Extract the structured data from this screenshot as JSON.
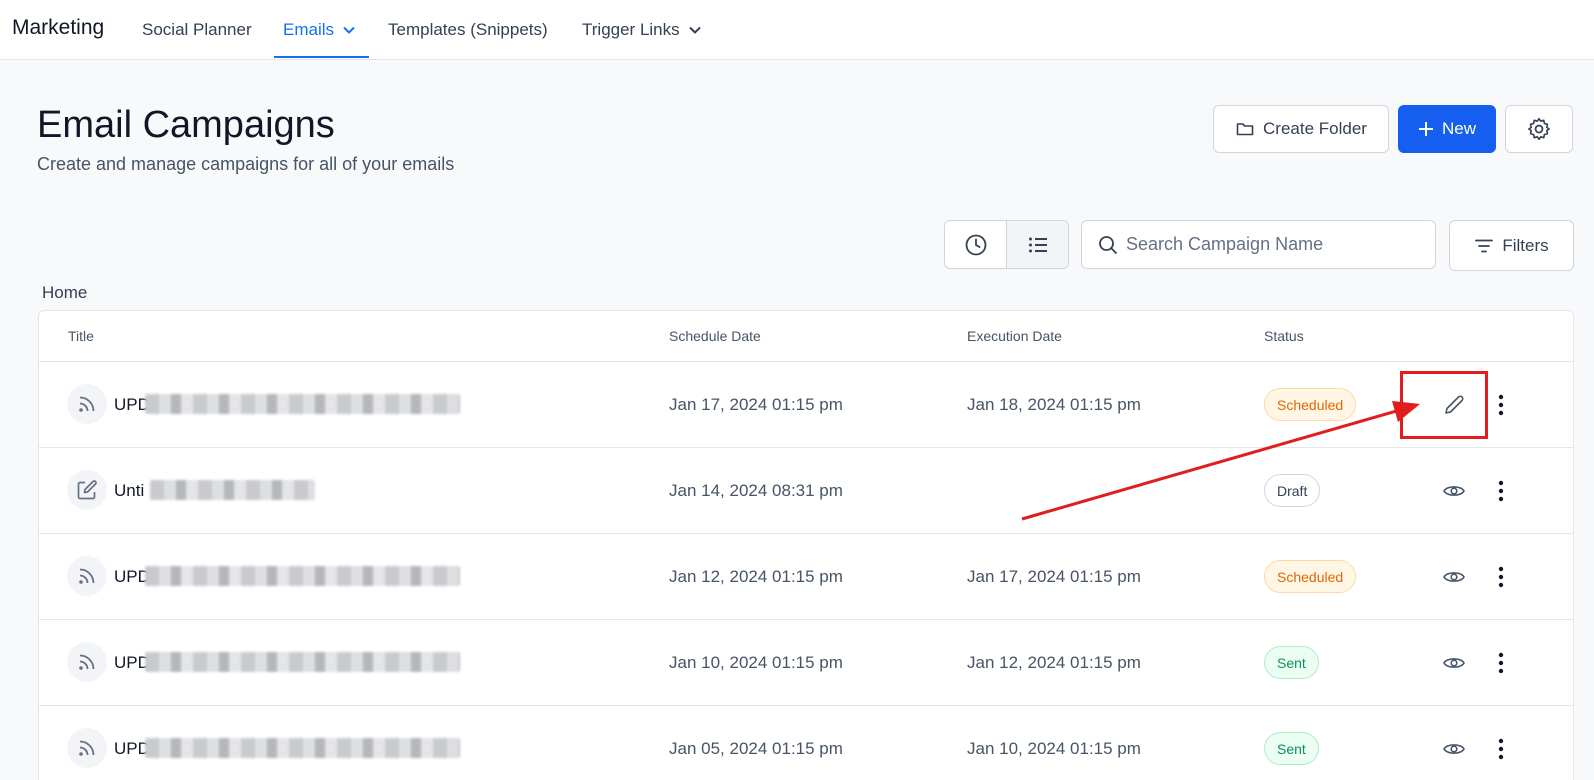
{
  "nav": {
    "brand": "Marketing",
    "items": [
      {
        "label": "Social Planner"
      },
      {
        "label": "Emails"
      },
      {
        "label": "Templates (Snippets)"
      },
      {
        "label": "Trigger Links"
      }
    ]
  },
  "header": {
    "title": "Email Campaigns",
    "subtitle": "Create and manage campaigns for all of your emails",
    "create_folder": "Create Folder",
    "new": "New"
  },
  "toolbar": {
    "search_placeholder": "Search Campaign Name",
    "filters": "Filters"
  },
  "breadcrumb": "Home",
  "table": {
    "headers": {
      "title": "Title",
      "schedule": "Schedule Date",
      "execution": "Execution Date",
      "status": "Status"
    },
    "rows": [
      {
        "icon": "rss-icon",
        "title": "UPD",
        "schedule": "Jan 17, 2024 01:15 pm",
        "execution": "Jan 18, 2024 01:15 pm",
        "status": "Scheduled",
        "action_icon": "pencil-icon"
      },
      {
        "icon": "edit-icon",
        "title": "Unti",
        "schedule": "Jan 14, 2024 08:31 pm",
        "execution": "",
        "status": "Draft",
        "action_icon": "eye-icon"
      },
      {
        "icon": "rss-icon",
        "title": "UPD",
        "schedule": "Jan 12, 2024 01:15 pm",
        "execution": "Jan 17, 2024 01:15 pm",
        "status": "Scheduled",
        "action_icon": "eye-icon"
      },
      {
        "icon": "rss-icon",
        "title": "UPD",
        "schedule": "Jan 10, 2024 01:15 pm",
        "execution": "Jan 12, 2024 01:15 pm",
        "status": "Sent",
        "action_icon": "eye-icon"
      },
      {
        "icon": "rss-icon",
        "title": "UPD",
        "schedule": "Jan 05, 2024 01:15 pm",
        "execution": "Jan 10, 2024 01:15 pm",
        "status": "Sent",
        "action_icon": "eye-icon"
      }
    ]
  },
  "colors": {
    "accent": "#155eef",
    "annotation": "#e11d1d"
  }
}
